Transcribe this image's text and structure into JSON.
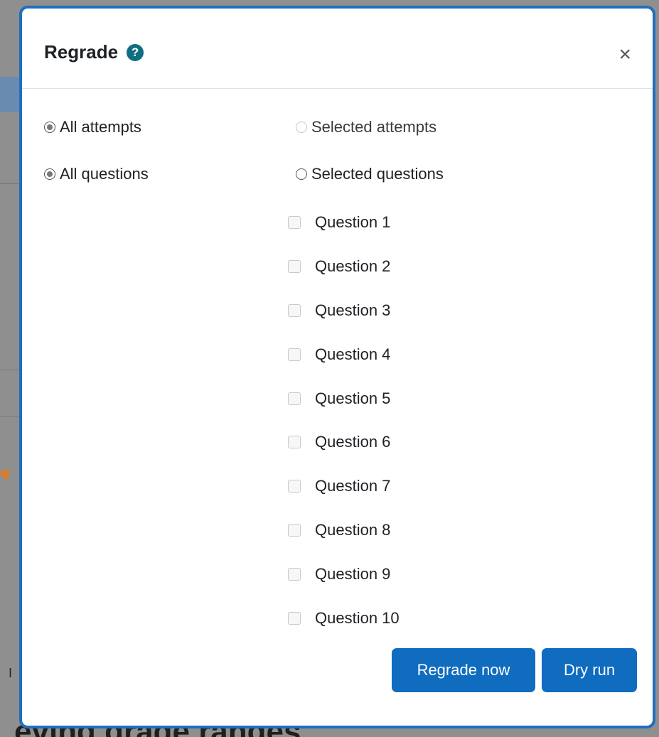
{
  "background": {
    "heading_fragment": "eving grade ranges",
    "small_mark": "I"
  },
  "modal": {
    "title": "Regrade",
    "help_icon_glyph": "?",
    "close_glyph": "×",
    "attempts": {
      "all_label": "All attempts",
      "all_checked": true,
      "selected_label": "Selected attempts",
      "selected_disabled": true
    },
    "questions": {
      "all_label": "All questions",
      "all_checked": true,
      "selected_label": "Selected questions",
      "items": [
        {
          "label": "Question 1",
          "checked": false
        },
        {
          "label": "Question 2",
          "checked": false
        },
        {
          "label": "Question 3",
          "checked": false
        },
        {
          "label": "Question 4",
          "checked": false
        },
        {
          "label": "Question 5",
          "checked": false
        },
        {
          "label": "Question 6",
          "checked": false
        },
        {
          "label": "Question 7",
          "checked": false
        },
        {
          "label": "Question 8",
          "checked": false
        },
        {
          "label": "Question 9",
          "checked": false
        },
        {
          "label": "Question 10",
          "checked": false
        }
      ]
    },
    "buttons": {
      "regrade_now": "Regrade now",
      "dry_run": "Dry run"
    }
  },
  "colors": {
    "primary": "#0f6cbf",
    "help_icon": "#0f6f80",
    "modal_border": "#1f6fbf"
  },
  "icons": {
    "help": "question-circle-icon",
    "close": "close-icon"
  }
}
